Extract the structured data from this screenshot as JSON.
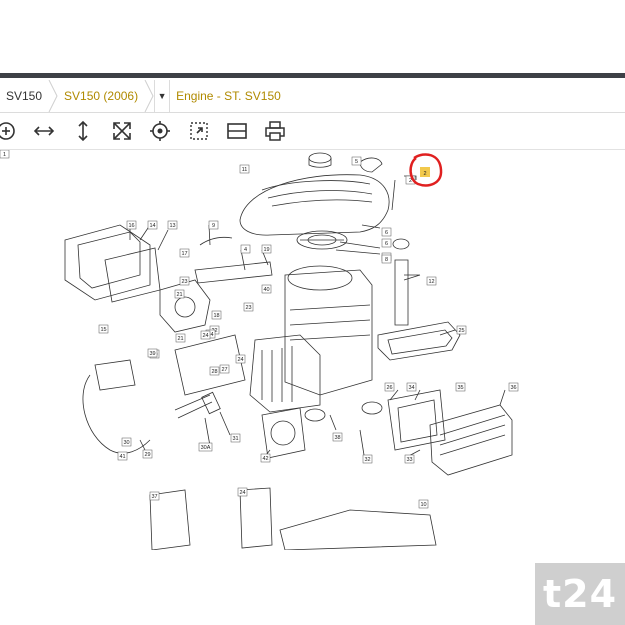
{
  "breadcrumb": {
    "items": [
      "SV150",
      "SV150 (2006)",
      "Engine - ST. SV150"
    ],
    "dropdown_glyph": "▼"
  },
  "toolbar": {
    "icons": [
      "zoom-in-icon",
      "fit-width-icon",
      "fit-height-icon",
      "fit-page-icon",
      "center-target-icon",
      "select-area-icon",
      "list-view-icon",
      "print-icon"
    ]
  },
  "diagram": {
    "callouts": [
      "11",
      "6",
      "5",
      "6",
      "7",
      "2",
      "16",
      "14",
      "13",
      "9",
      "17",
      "19",
      "4",
      "8",
      "12",
      "23",
      "40",
      "23",
      "18",
      "22",
      "24",
      "21",
      "24",
      "21",
      "15",
      "20",
      "39",
      "24",
      "28",
      "27",
      "25",
      "26",
      "34",
      "35",
      "36",
      "38",
      "41",
      "29",
      "30",
      "30A",
      "31",
      "42",
      "32",
      "33",
      "37",
      "24",
      "10",
      "1"
    ],
    "highlighted_callout": "2",
    "highlight_color": "#e02020",
    "highlight_fill": "#f2c94c"
  },
  "watermark": {
    "text": "t24",
    "bg": "#cfcfcf"
  },
  "colors": {
    "topbar": "#3d4046",
    "accent_text": "#b08a00"
  }
}
